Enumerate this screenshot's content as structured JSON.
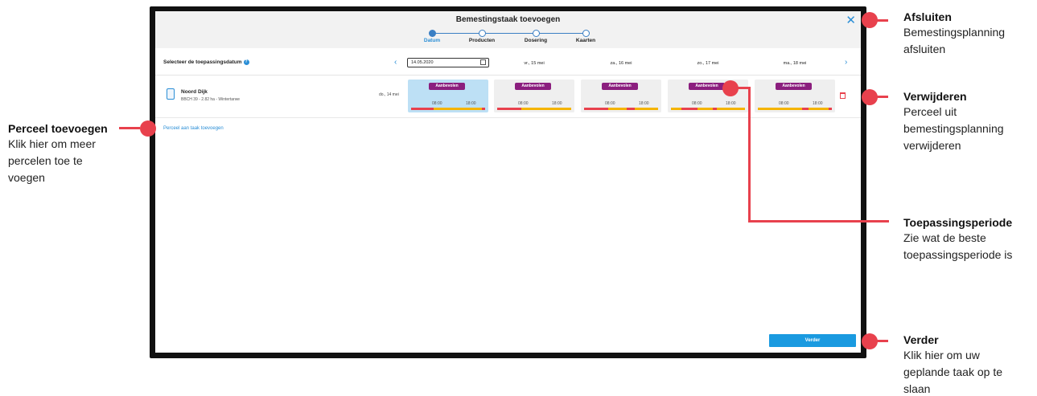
{
  "dialog": {
    "title": "Bemestingstaak toevoegen",
    "steps": [
      "Datum",
      "Producten",
      "Dosering",
      "Kaarten"
    ],
    "active_step": 0
  },
  "datebar": {
    "label": "Selecteer de toepassingsdatum",
    "help_icon": "?",
    "date_value": "14.05.2020",
    "days": [
      "vr., 15 mei",
      "za., 16 mei",
      "zo., 17 mei",
      "ma., 18 mei"
    ],
    "prev_icon": "chevron-left",
    "next_icon": "chevron-right"
  },
  "field": {
    "name": "Noord Dijk",
    "sub": "BBCH 39 - 2.82 ha - Wintertarwe",
    "day": "do., 14 mei",
    "cells": [
      {
        "badge": "Aanbevolen",
        "t1": "08:00",
        "t2": "18:00"
      },
      {
        "badge": "Aanbevolen",
        "t1": "08:00",
        "t2": "18:00"
      },
      {
        "badge": "Aanbevolen",
        "t1": "08:00",
        "t2": "18:00"
      },
      {
        "badge": "Aanbevolen",
        "t1": "08:00",
        "t2": "18:00"
      },
      {
        "badge": "Aanbevolen",
        "t1": "08:00",
        "t2": "18:00"
      }
    ]
  },
  "add_field_link": "Perceel aan taak toevoegen",
  "next_button": "Verder",
  "annotations": {
    "close": {
      "title": "Afsluiten",
      "lines": [
        "Bemestingsplanning",
        "afsluiten"
      ]
    },
    "delete": {
      "title": "Verwijderen",
      "lines": [
        "Perceel uit",
        "bemestingsplanning",
        "verwijderen"
      ]
    },
    "period": {
      "title": "Toepassingsperiode",
      "lines": [
        "Zie wat de beste",
        "toepassingsperiode is"
      ]
    },
    "next": {
      "title": "Verder",
      "lines": [
        "Klik hier om uw",
        "geplande taak op te",
        "slaan"
      ]
    },
    "add": {
      "title": "Perceel toevoegen",
      "lines": [
        "Klik hier om meer",
        "percelen toe te",
        "voegen"
      ]
    }
  },
  "colors": {
    "annotation": "#e8414d",
    "accent": "#2a8ed6",
    "badge": "#8b1e7e",
    "button": "#1a9ae0"
  }
}
